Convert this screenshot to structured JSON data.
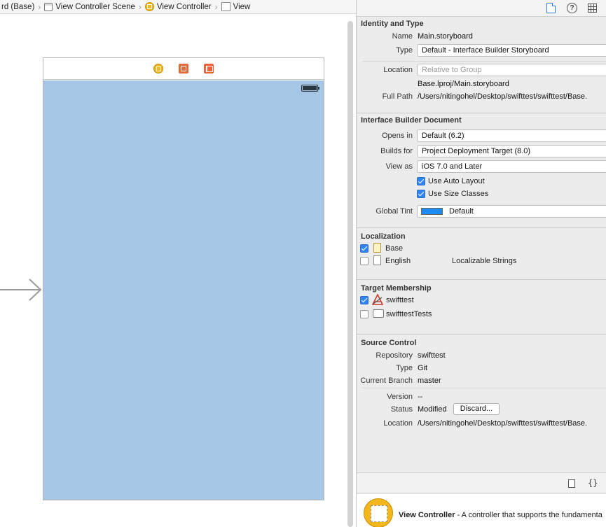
{
  "breadcrumb": {
    "items": [
      "rd (Base)",
      "View Controller Scene",
      "View Controller",
      "View"
    ]
  },
  "inspector": {
    "identity": {
      "title": "Identity and Type",
      "name_label": "Name",
      "name_value": "Main.storyboard",
      "type_label": "Type",
      "type_value": "Default - Interface Builder Storyboard",
      "location_label": "Location",
      "location_value": "Relative to Group",
      "location_path": "Base.lproj/Main.storyboard",
      "fullpath_label": "Full Path",
      "fullpath_value": "/Users/nitingohel/Desktop/swifttest/swifttest/Base."
    },
    "ib_document": {
      "title": "Interface Builder Document",
      "opens_in_label": "Opens in",
      "opens_in_value": "Default (6.2)",
      "builds_for_label": "Builds for",
      "builds_for_value": "Project Deployment Target (8.0)",
      "view_as_label": "View as",
      "view_as_value": "iOS 7.0 and Later",
      "auto_layout_label": "Use Auto Layout",
      "size_classes_label": "Use Size Classes",
      "global_tint_label": "Global Tint",
      "global_tint_value": "Default",
      "global_tint_color": "#1d8bf5"
    },
    "localization": {
      "title": "Localization",
      "items": [
        {
          "label": "Base",
          "checked": true,
          "extra": ""
        },
        {
          "label": "English",
          "checked": false,
          "extra": "Localizable Strings"
        }
      ]
    },
    "target_membership": {
      "title": "Target Membership",
      "items": [
        {
          "label": "swifttest",
          "checked": true
        },
        {
          "label": "swifttestTests",
          "checked": false
        }
      ]
    },
    "source_control": {
      "title": "Source Control",
      "repository_label": "Repository",
      "repository_value": "swifttest",
      "type_label": "Type",
      "type_value": "Git",
      "branch_label": "Current Branch",
      "branch_value": "master",
      "version_label": "Version",
      "version_value": "--",
      "status_label": "Status",
      "status_value": "Modified",
      "discard_label": "Discard...",
      "location_label": "Location",
      "location_value": "/Users/nitingohel/Desktop/swifttest/swifttest/Base."
    },
    "library": {
      "item_title": "View Controller",
      "item_desc": " - A controller that supports the fundamenta"
    }
  },
  "canvas": {
    "view_color": "#a5c6e5"
  }
}
